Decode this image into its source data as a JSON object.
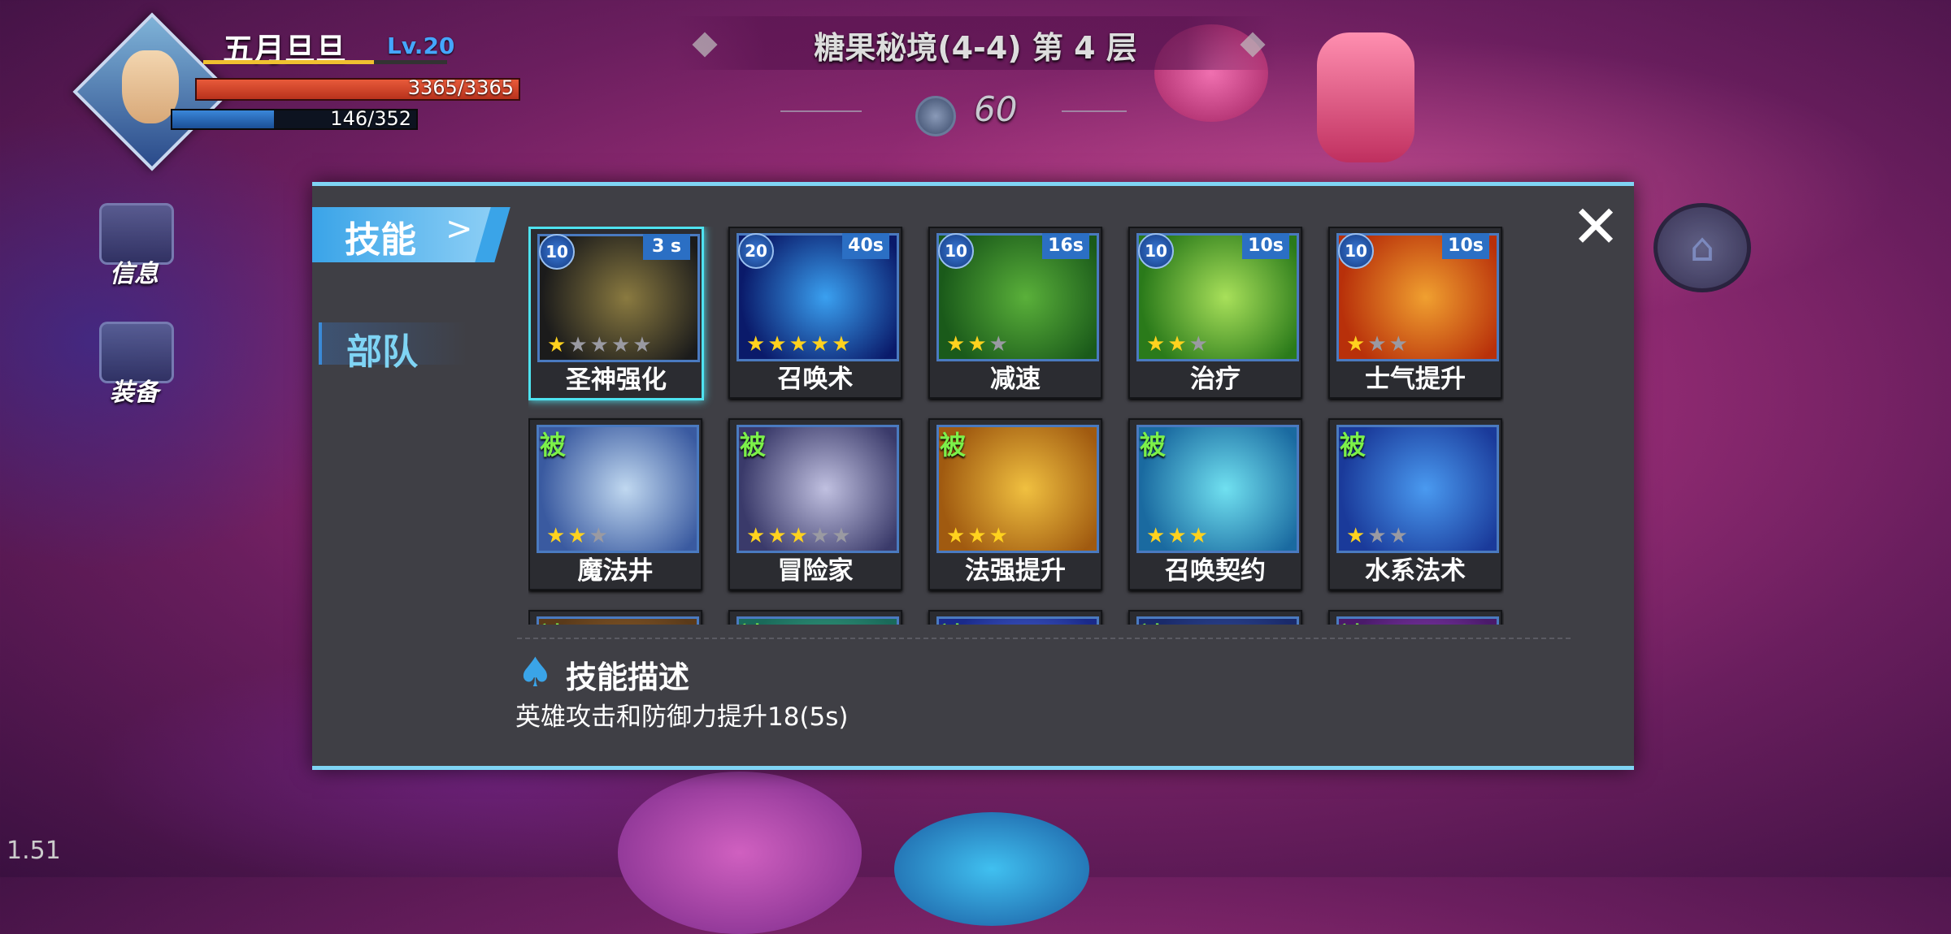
{
  "hud": {
    "player_name": "五月旦旦",
    "level": "Lv.20",
    "hp_text": "3365/3365",
    "hp_fraction": 1.0,
    "mp_text": "146/352",
    "mp_fraction": 0.415,
    "stage_title": "糖果秘境(4-4) 第 4 层",
    "currency_value": "60",
    "version": "1.51"
  },
  "side_buttons": [
    {
      "label": "信息",
      "icon": "mail-icon"
    },
    {
      "label": "装备",
      "icon": "bag-icon"
    }
  ],
  "dialog": {
    "tab_skill": "技能",
    "tab_skill_arrow": ">",
    "tab_troop": "部队",
    "close_glyph": "✕",
    "description_title": "技能描述",
    "description_text": "英雄攻击和防御力提升18(5s)"
  },
  "skills": [
    {
      "name": "圣神强化",
      "level": "10",
      "cooldown": "3 s",
      "passive": "",
      "stars": 1,
      "selected": true,
      "color_a": "#1b1b1b",
      "color_b": "#8a7a40",
      "art": "sword-icon"
    },
    {
      "name": "召唤术",
      "level": "20",
      "cooldown": "40s",
      "passive": "",
      "stars": 5,
      "selected": false,
      "color_a": "#0a1a6a",
      "color_b": "#3aa0f0",
      "art": "lightning-icon"
    },
    {
      "name": "减速",
      "level": "10",
      "cooldown": "16s",
      "passive": "",
      "stars": 2,
      "selected": false,
      "color_a": "#1a5a1a",
      "color_b": "#5ab03a",
      "art": "snail-icon"
    },
    {
      "name": "治疗",
      "level": "10",
      "cooldown": "10s",
      "passive": "",
      "stars": 2,
      "selected": false,
      "color_a": "#2a7a1a",
      "color_b": "#a8e05a",
      "art": "leaf-icon"
    },
    {
      "name": "士气提升",
      "level": "10",
      "cooldown": "10s",
      "passive": "",
      "stars": 1,
      "selected": false,
      "color_a": "#b8300a",
      "color_b": "#f0a030",
      "art": "muscle-icon"
    },
    {
      "name": "魔法井",
      "level": "",
      "cooldown": "",
      "passive": "被",
      "stars": 2,
      "selected": false,
      "color_a": "#3a5aa0",
      "color_b": "#c0d8f0",
      "art": "well-icon"
    },
    {
      "name": "冒险家",
      "level": "",
      "cooldown": "",
      "passive": "被",
      "stars": 3,
      "selected": false,
      "color_a": "#3a3a6a",
      "color_b": "#c0c0e0",
      "art": "owl-icon"
    },
    {
      "name": "法强提升",
      "level": "",
      "cooldown": "",
      "passive": "被",
      "stars": 3,
      "selected": false,
      "color_a": "#a05a10",
      "color_b": "#f0c040",
      "art": "ring-icon"
    },
    {
      "name": "召唤契约",
      "level": "",
      "cooldown": "",
      "passive": "被",
      "stars": 3,
      "selected": false,
      "color_a": "#1a6aa0",
      "color_b": "#70e0f0",
      "art": "scroll-icon"
    },
    {
      "name": "水系法术",
      "level": "",
      "cooldown": "",
      "passive": "被",
      "stars": 1,
      "selected": false,
      "color_a": "#1a3a9a",
      "color_b": "#4a9af0",
      "art": "skull-icon"
    },
    {
      "name": "",
      "level": "",
      "cooldown": "",
      "passive": "被",
      "stars": 0,
      "selected": false,
      "color_a": "#5a3a1a",
      "color_b": "#a06a30",
      "art": ""
    },
    {
      "name": "",
      "level": "",
      "cooldown": "",
      "passive": "被",
      "stars": 0,
      "selected": false,
      "color_a": "#1a6a5a",
      "color_b": "#40b090",
      "art": ""
    },
    {
      "name": "",
      "level": "",
      "cooldown": "",
      "passive": "被",
      "stars": 0,
      "selected": false,
      "color_a": "#1a2a8a",
      "color_b": "#5a7af0",
      "art": ""
    },
    {
      "name": "",
      "level": "",
      "cooldown": "",
      "passive": "被",
      "stars": 0,
      "selected": false,
      "color_a": "#1a2a6a",
      "color_b": "#3a5ab0",
      "art": ""
    },
    {
      "name": "",
      "level": "",
      "cooldown": "",
      "passive": "被",
      "stars": 0,
      "selected": false,
      "color_a": "#4a1a6a",
      "color_b": "#a04ad0",
      "art": ""
    }
  ],
  "colors": {
    "accent": "#7fd4f4",
    "selected_border": "#4ee3f0",
    "passive_green": "#7cf04a",
    "star_gold": "#ffd21e"
  }
}
